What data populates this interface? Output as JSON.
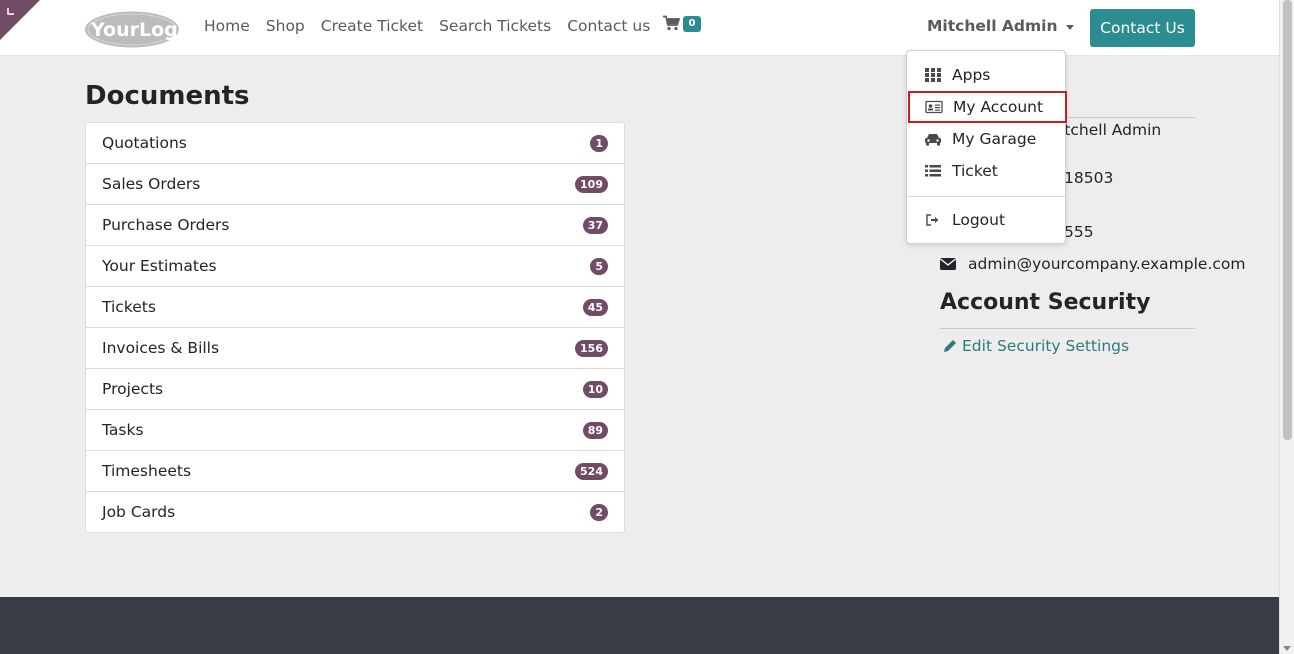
{
  "header": {
    "logo_text": "YourLogo",
    "nav": [
      "Home",
      "Shop",
      "Create Ticket",
      "Search Tickets",
      "Contact us"
    ],
    "cart_count": "0",
    "user_name": "Mitchell Admin",
    "contact_button": "Contact Us"
  },
  "documents": {
    "title": "Documents",
    "items": [
      {
        "label": "Quotations",
        "count": "1"
      },
      {
        "label": "Sales Orders",
        "count": "109"
      },
      {
        "label": "Purchase Orders",
        "count": "37"
      },
      {
        "label": "Your Estimates",
        "count": "5"
      },
      {
        "label": "Tickets",
        "count": "45"
      },
      {
        "label": "Invoices & Bills",
        "count": "156"
      },
      {
        "label": "Projects",
        "count": "10"
      },
      {
        "label": "Tasks",
        "count": "89"
      },
      {
        "label": "Timesheets",
        "count": "524"
      },
      {
        "label": "Job Cards",
        "count": "2"
      }
    ]
  },
  "details": {
    "name_fragment": "itchell Admin",
    "phone_fragment": "18503",
    "fax_fragment": "555",
    "email": "admin@yourcompany.example.com"
  },
  "security": {
    "title": "Account Security",
    "edit_link": "Edit Security Settings"
  },
  "user_dropdown": {
    "items": [
      {
        "label": "Apps",
        "icon": "apps-grid-icon"
      },
      {
        "label": "My Account",
        "icon": "id-card-icon"
      },
      {
        "label": "My Garage",
        "icon": "car-icon"
      },
      {
        "label": "Ticket",
        "icon": "list-icon"
      },
      {
        "label": "Logout",
        "icon": "logout-icon"
      }
    ]
  },
  "colors": {
    "primary": "#2b8d92",
    "badge": "#714b67",
    "highlight": "#d11a1a",
    "footer": "#383d45"
  }
}
